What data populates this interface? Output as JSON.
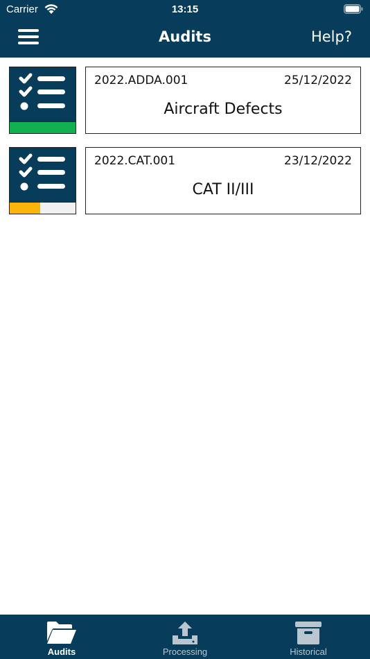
{
  "status_bar": {
    "carrier": "Carrier",
    "time": "13:15"
  },
  "nav": {
    "title": "Audits",
    "help_label": "Help?"
  },
  "audits": [
    {
      "code": "2022.ADDA.001",
      "date": "25/12/2022",
      "name": "Aircraft Defects",
      "progress": 1.0,
      "progress_color": "#12b04e"
    },
    {
      "code": "2022.CAT.001",
      "date": "23/12/2022",
      "name": "CAT II/III",
      "progress": 0.46,
      "progress_color": "#fdb40a"
    }
  ],
  "tabs": [
    {
      "label": "Audits",
      "icon": "folder-open-icon",
      "active": true
    },
    {
      "label": "Processing",
      "icon": "upload-tray-icon",
      "active": false
    },
    {
      "label": "Historical",
      "icon": "archive-box-icon",
      "active": false
    }
  ],
  "colors": {
    "brand": "#073c5a",
    "tab_active": "#ffffff",
    "tab_inactive": "#b9c6cf"
  }
}
